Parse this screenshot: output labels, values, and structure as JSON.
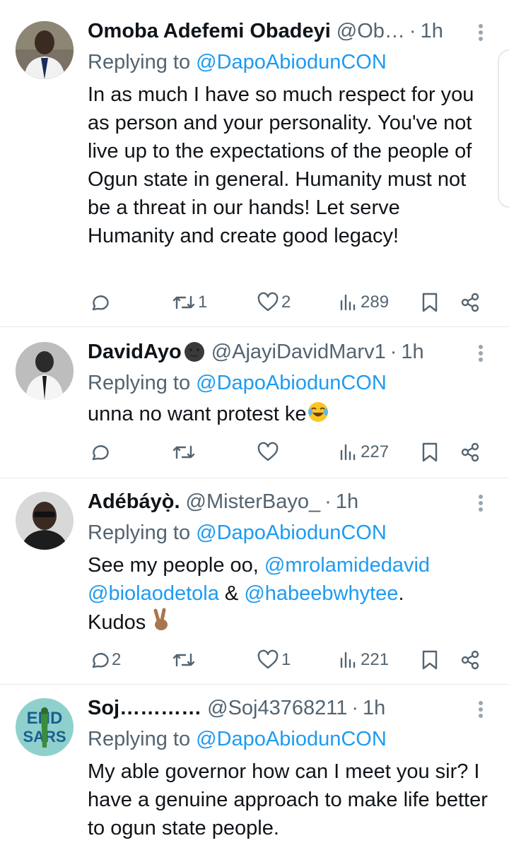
{
  "replies": [
    {
      "name": "Omoba Adefemi Obadeyi",
      "handle": "@Ob…",
      "time": "1h",
      "replying_prefix": "Replying to ",
      "replying_to": "@DapoAbiodunCON",
      "text": "In as much I  have so much respect for you as person and your personality. You've not live up to the expectations of the people of Ogun state in general. Humanity must not be a threat in our hands! Let serve Humanity and create good legacy!",
      "reply_count": "",
      "repost_count": "1",
      "like_count": "2",
      "view_count": "289",
      "avatar_colors": [
        "#8a7d6c",
        "#2a2a2a"
      ]
    },
    {
      "name": "DavidAyo",
      "name_emoji": "new-moon-face-icon",
      "handle": "@AjayiDavidMarv1",
      "time": "1h",
      "replying_prefix": "Replying to ",
      "replying_to": "@DapoAbiodunCON",
      "text": "unna no want protest ke",
      "text_emoji": "crying-laughing-face-icon",
      "reply_count": "",
      "repost_count": "",
      "like_count": "",
      "view_count": "227"
    },
    {
      "name": "Adébáyọ̀.",
      "handle": "@MisterBayo_",
      "time": "1h",
      "replying_prefix": "Replying to ",
      "replying_to": "@DapoAbiodunCON",
      "text_prefix": "See my people oo, ",
      "mention_1": "@mrolamidedavid",
      "mention_2": "@biolaodetola",
      "text_mid": " & ",
      "mention_3": "@habeebwhytee",
      "text_suffix": ".",
      "text_line3": "Kudos ",
      "text_emoji": "victory-hand-icon",
      "reply_count": "2",
      "repost_count": "",
      "like_count": "1",
      "view_count": "221"
    },
    {
      "name": "Soj…………",
      "handle": "@Soj43768211",
      "time": "1h",
      "replying_prefix": "Replying to ",
      "replying_to": "@DapoAbiodunCON",
      "text": "My able governor how can I meet you sir? I have a genuine approach to make life better to ogun state people.",
      "avatar_text": "END SARS"
    }
  ],
  "colors": {
    "accent": "#1d9bf0",
    "secondary_text": "#536471",
    "primary_text": "#0f1419",
    "divider": "#e6e9eb"
  }
}
